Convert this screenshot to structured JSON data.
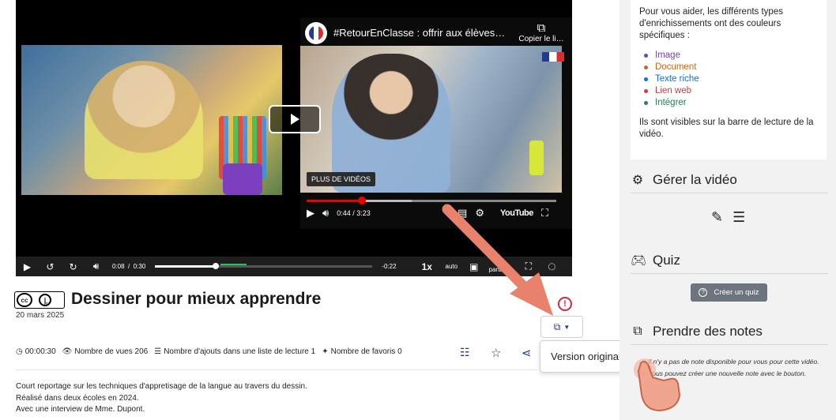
{
  "player": {
    "youtube": {
      "title": "#RetourEnClasse : offrir aux élèves un…",
      "copy_label": "Copier le li…",
      "more_videos": "PLUS DE VIDÉOS",
      "time": "0:44 / 3:23",
      "brand": "YouTube",
      "progress_fraction": 0.22
    },
    "controls": {
      "current_time": "0:08",
      "separator": "/",
      "duration": "0:30",
      "remaining": "-0:22",
      "rate": "1x",
      "quality": "auto",
      "share_line1": "Vue",
      "share_line2": "partagée",
      "progress_fraction": 0.28
    }
  },
  "video": {
    "title": "Dessiner pour mieux apprendre",
    "date": "20 mars 2025",
    "license": "cc by"
  },
  "version_menu": {
    "option": "Version originale"
  },
  "stats": {
    "duration": "00:00:30",
    "views": "Nombre de vues 206",
    "playlists": "Nombre d'ajouts dans une liste de lecture 1",
    "favorites": "Nombre de favoris 0"
  },
  "description": {
    "line1": "Court reportage sur les techniques d'appretisage de la langue au travers du dessin.",
    "line2": "Réalisé dans deux écoles en 2024.",
    "line3": "Avec une interview de Mme. Dupont."
  },
  "sidebar": {
    "info_intro": "Pour vous aider, les différents types d'enrichissements ont des couleurs spécifiques :",
    "enrich_types": [
      {
        "label": "Image",
        "color": "#6f42c1"
      },
      {
        "label": "Document",
        "color": "#d3640e"
      },
      {
        "label": "Texte riche",
        "color": "#0d6efd"
      },
      {
        "label": "Lien web",
        "color": "#dc3545"
      },
      {
        "label": "Intégrer",
        "color": "#198754"
      }
    ],
    "info_outro": "Ils sont visibles sur la barre de lecture de la vidéo.",
    "manage_title": "Gérer la vidéo",
    "quiz_title": "Quiz",
    "quiz_button": "Créer un quiz",
    "notes_title": "Prendre des notes",
    "notes_line1": "Il n'y a pas de note disponible pour vous pour cette vidéo.",
    "notes_line2": "Vous pouvez créer une nouvelle note avec le bouton."
  },
  "colors": {
    "accent": "#1f3a8a",
    "alert": "#d6293e",
    "annotation_arrow": "#e8826d",
    "sidebar_bg": "#f2f2f2"
  }
}
